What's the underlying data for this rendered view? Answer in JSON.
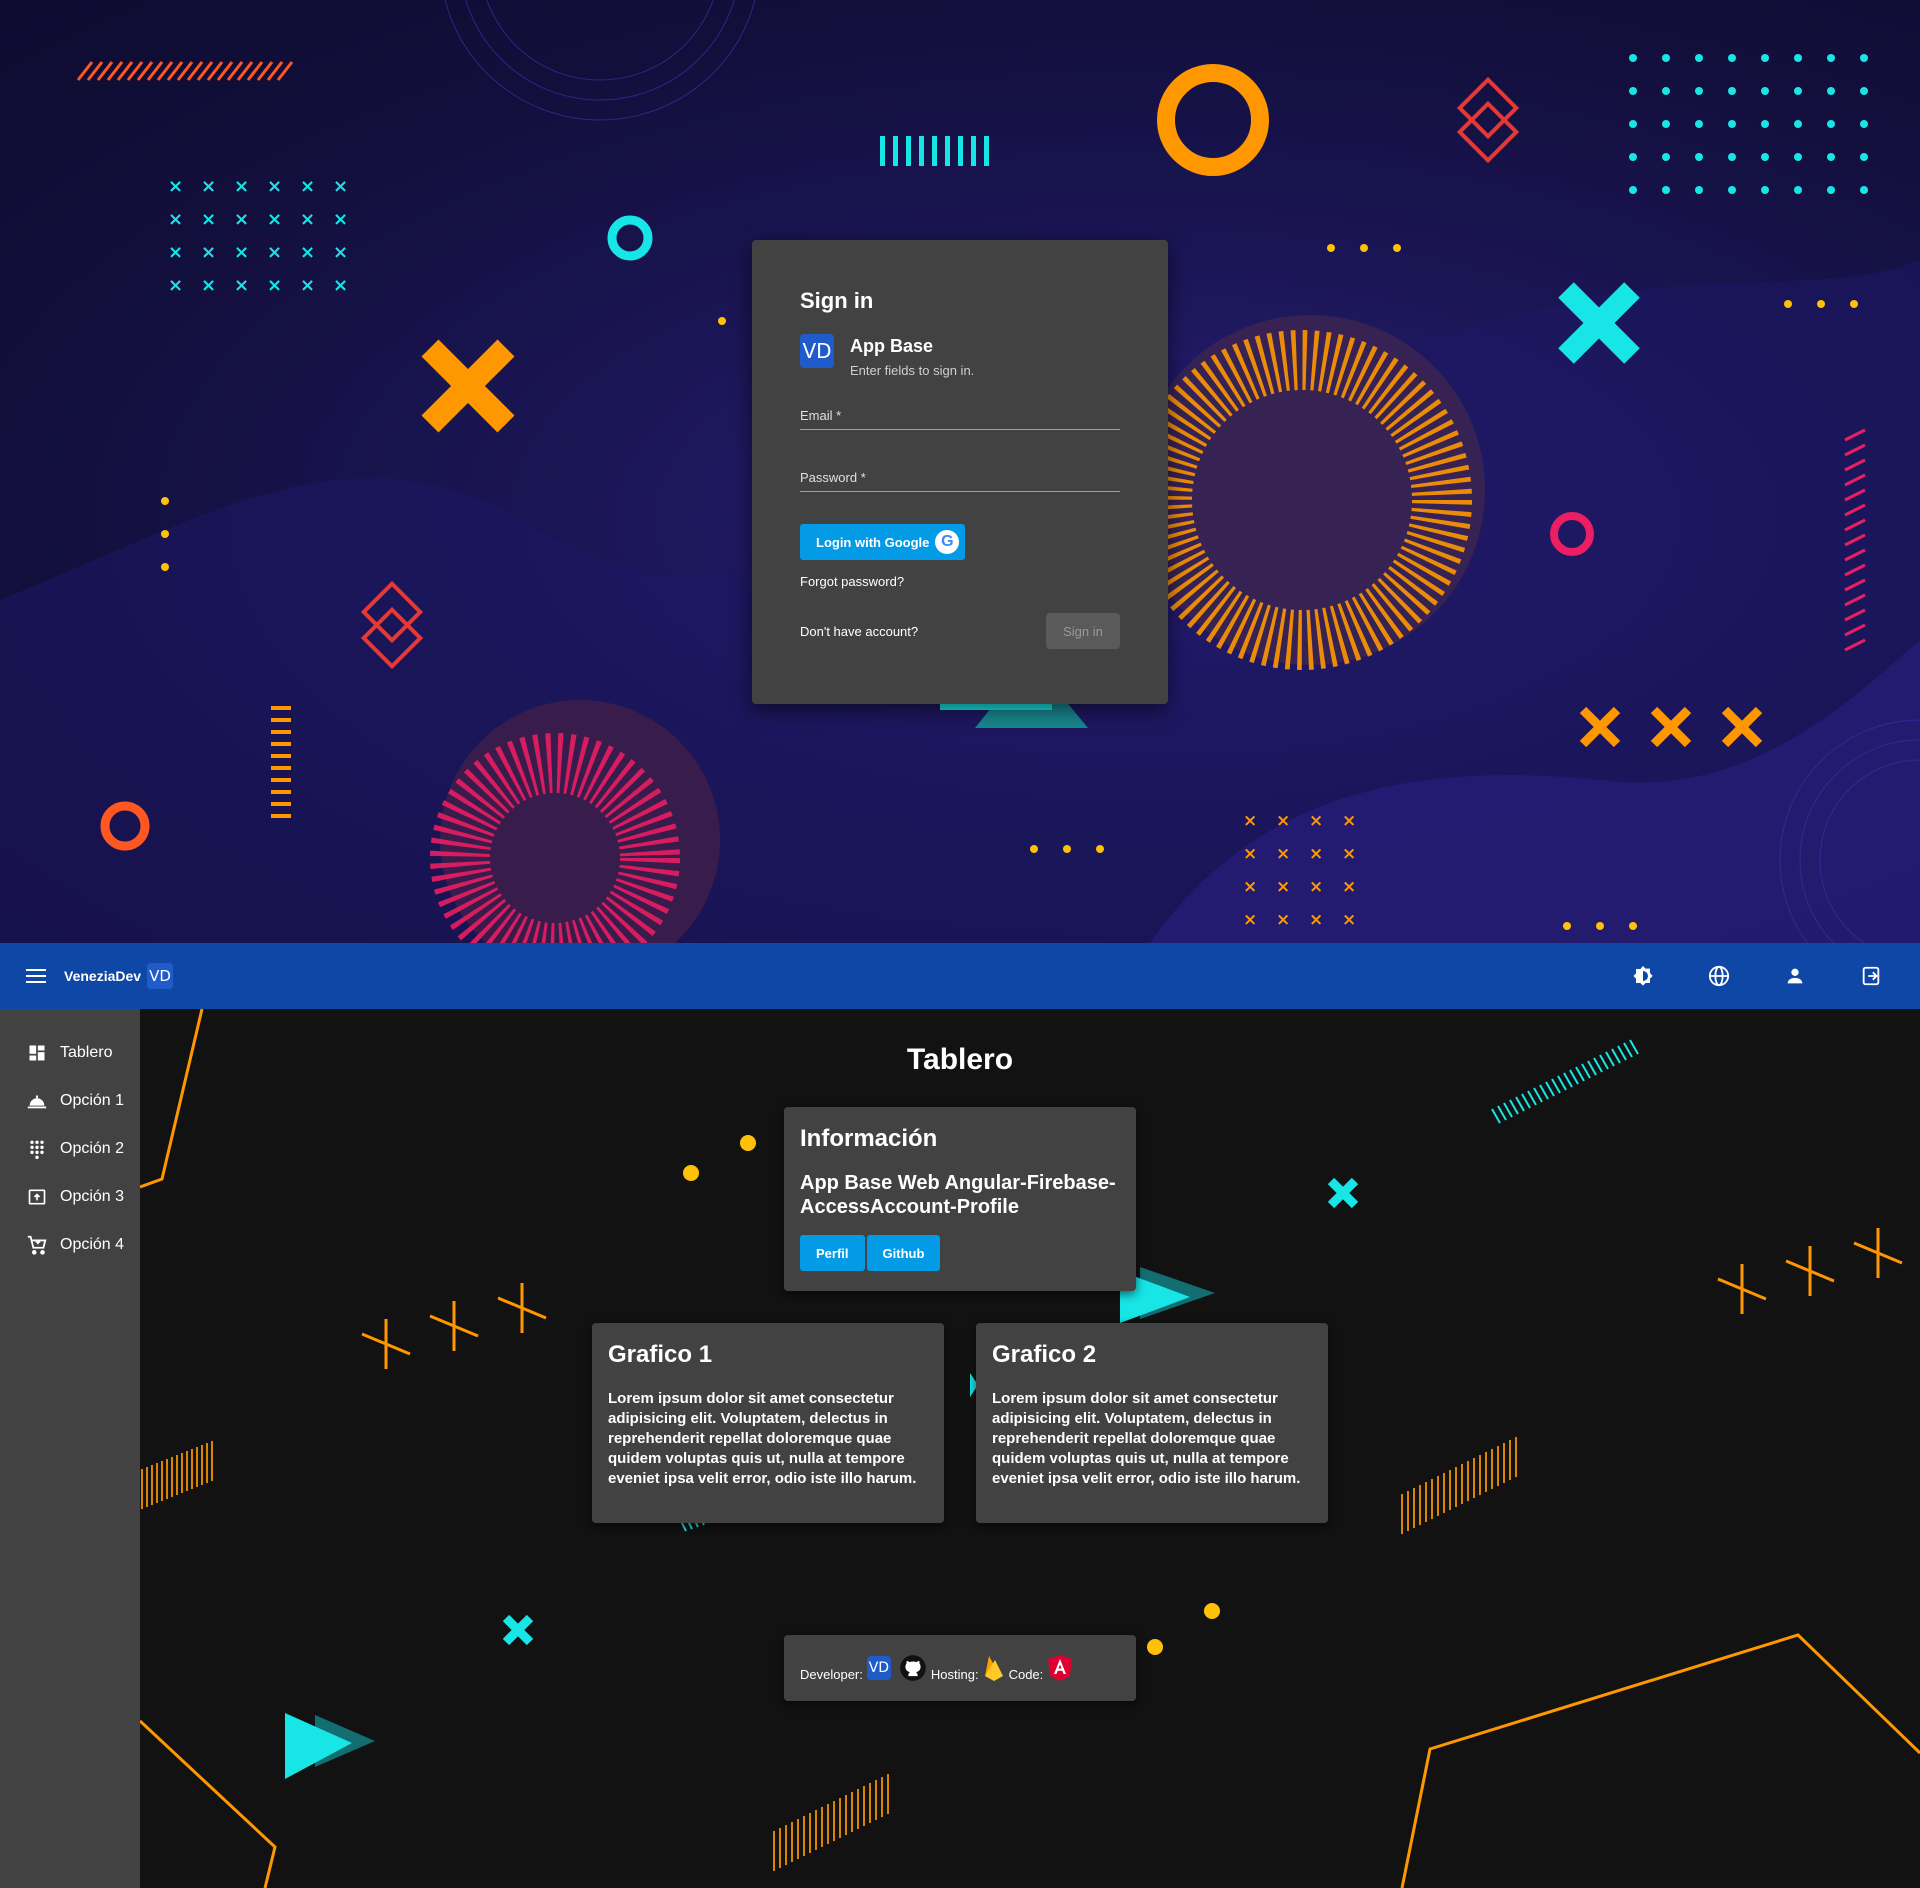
{
  "login": {
    "title": "Sign in",
    "app_name": "App Base",
    "app_subtitle": "Enter fields to sign in.",
    "logo_text": "VD",
    "email_label": "Email *",
    "password_label": "Password *",
    "google_button": "Login with Google",
    "forgot": "Forgot password?",
    "no_account": "Don't have account?",
    "signin_button": "Sign in"
  },
  "toolbar": {
    "brand": "VeneziaDev",
    "logo_text": "VD"
  },
  "sidenav": {
    "items": [
      {
        "label": "Tablero",
        "icon": "dashboard-icon"
      },
      {
        "label": "Opción 1",
        "icon": "room-service-icon"
      },
      {
        "label": "Opción 2",
        "icon": "dialpad-icon"
      },
      {
        "label": "Opción 3",
        "icon": "upload-box-icon"
      },
      {
        "label": "Opción 4",
        "icon": "cart-icon"
      }
    ]
  },
  "dashboard": {
    "title": "Tablero",
    "info": {
      "heading": "Información",
      "subheading": "App Base Web Angular-Firebase-AccessAccount-Profile",
      "buttons": [
        "Perfil",
        "Github"
      ]
    },
    "charts": [
      {
        "heading": "Grafico 1",
        "text": "Lorem ipsum dolor sit amet consectetur adipisicing elit. Voluptatem, delectus in reprehenderit repellat doloremque quae quidem voluptas quis ut, nulla at tempore eveniet ipsa velit error, odio iste illo harum."
      },
      {
        "heading": "Grafico 2",
        "text": "Lorem ipsum dolor sit amet consectetur adipisicing elit. Voluptatem, delectus in reprehenderit repellat doloremque quae quidem voluptas quis ut, nulla at tempore eveniet ipsa velit error, odio iste illo harum."
      }
    ],
    "footer": {
      "developer": "Developer:",
      "hosting": "Hosting:",
      "code": "Code:",
      "logo_text": "VD"
    }
  },
  "colors": {
    "toolbar": "#0f47a7",
    "accent_blue": "#039be5",
    "card": "#424242",
    "orange": "#ff9800",
    "cyan": "#18e6e6",
    "pink": "#e91e63"
  }
}
